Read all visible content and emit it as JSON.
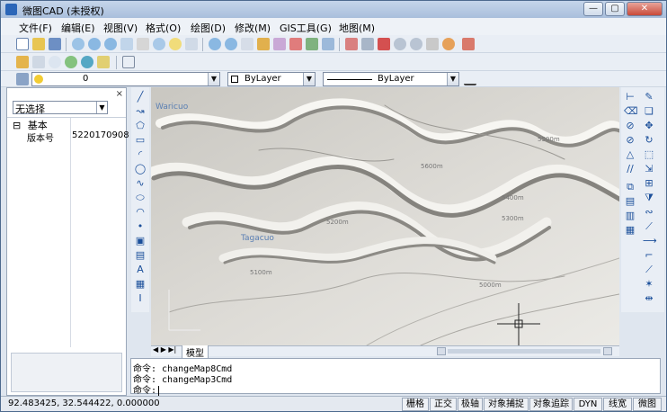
{
  "window": {
    "title": "微图CAD (未授权)",
    "controls": [
      "—",
      "▢",
      "✕"
    ]
  },
  "menu": [
    "文件(F)",
    "编辑(E)",
    "视图(V)",
    "格式(O)",
    "绘图(D)",
    "修改(M)",
    "GIS工具(G)",
    "地图(M)"
  ],
  "layer_toolbar": {
    "layer": "0",
    "color": "ByLayer",
    "linetype": "ByLayer"
  },
  "properties_panel": {
    "selection": "无选择",
    "group": "基本",
    "rows": [
      {
        "key": "版本号",
        "value": "5220170908"
      }
    ]
  },
  "map": {
    "labels": [
      "Waricuo",
      "Tagacuo"
    ],
    "contours": [
      "5500m",
      "5600m",
      "5400m",
      "5200m",
      "5000m",
      "5100m",
      "5300m"
    ]
  },
  "tabs": {
    "model": "模型"
  },
  "command": {
    "lines": [
      "命令: changeMap8Cmd",
      "命令: changeMap3Cmd"
    ],
    "prompt": "命令:"
  },
  "status": {
    "coords": "92.483425, 32.544422, 0.000000",
    "buttons": [
      "栅格",
      "正交",
      "极轴",
      "对象捕捉",
      "对象追踪",
      "DYN",
      "线宽",
      "微图"
    ]
  }
}
